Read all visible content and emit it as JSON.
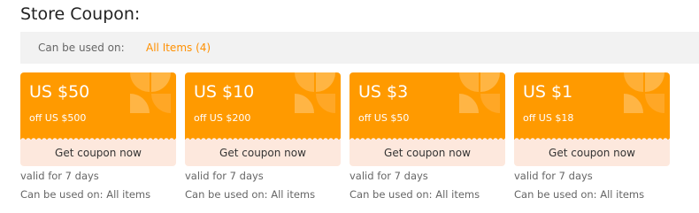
{
  "section": {
    "title": "Store Coupon:"
  },
  "filter": {
    "label": "Can be used on:",
    "value": "All Items (4)"
  },
  "colors": {
    "coupon_bg": "#ff9a00",
    "button_bg": "#fde8dd",
    "accent": "#ff9000"
  },
  "coupons": [
    {
      "amount": "US $50",
      "min_order": "off US $500",
      "button": "Get coupon now",
      "valid": "valid for 7 days",
      "usable": "Can be used on: All items"
    },
    {
      "amount": "US $10",
      "min_order": "off US $200",
      "button": "Get coupon now",
      "valid": "valid for 7 days",
      "usable": "Can be used on: All items"
    },
    {
      "amount": "US $3",
      "min_order": "off US $50",
      "button": "Get coupon now",
      "valid": "valid for 7 days",
      "usable": "Can be used on: All items"
    },
    {
      "amount": "US $1",
      "min_order": "off US $18",
      "button": "Get coupon now",
      "valid": "valid for 7 days",
      "usable": "Can be used on: All items"
    }
  ]
}
